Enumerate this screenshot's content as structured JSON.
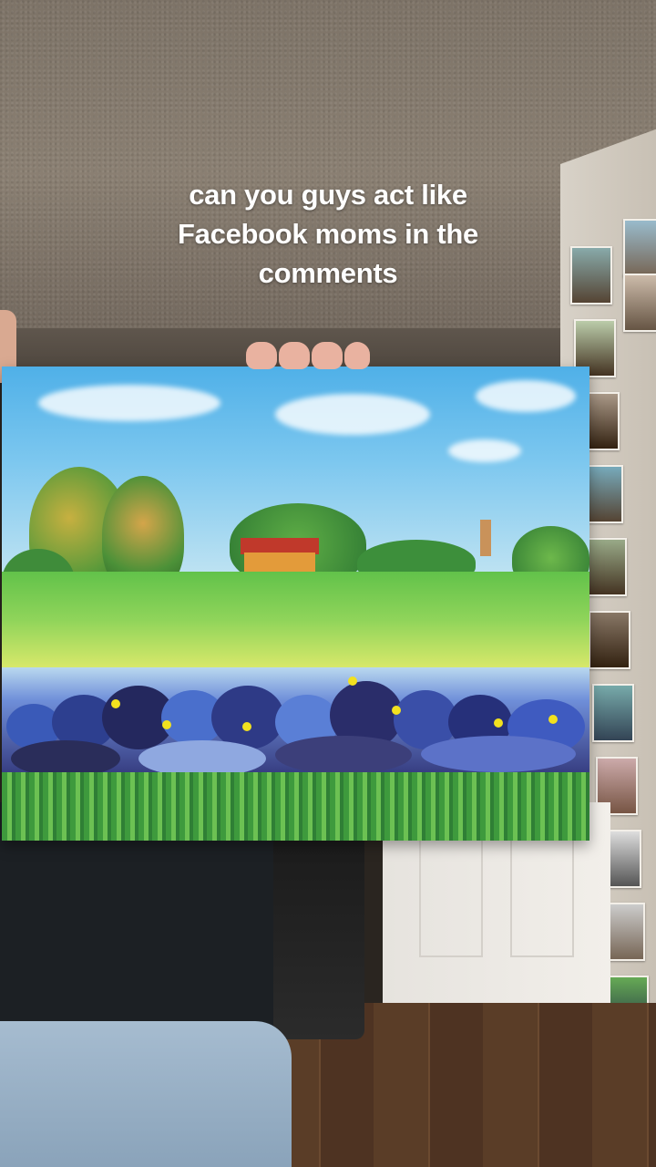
{
  "caption": {
    "line1": "can you guys act like",
    "line2": "Facebook moms in the",
    "line3": "comments"
  },
  "colors": {
    "caption_text": "#ffffff",
    "sky": "#4fb0e8",
    "bluebonnets": "#34397d",
    "field": "#8fd45a"
  }
}
